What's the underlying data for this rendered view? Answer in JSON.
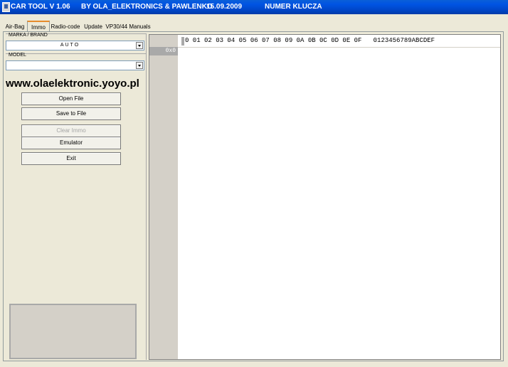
{
  "titlebar": {
    "app_title": "CAR TOOL V 1.06",
    "author": "BY OLA_ELEKTRONICS  &  PAWLENKO",
    "date": "15.09.2009",
    "key_label": "NUMER KLUCZA"
  },
  "tabs": [
    {
      "label": "Air-Bag",
      "active": false
    },
    {
      "label": "Immo",
      "active": true
    },
    {
      "label": "Radio-code",
      "active": false
    },
    {
      "label": "Update",
      "active": false
    },
    {
      "label": "VP30/44 Manuals",
      "active": false
    }
  ],
  "left": {
    "brand_label": "MARKA / BRAND",
    "brand_value": "AUTO",
    "model_label": "MODEL",
    "model_value": "",
    "website": "www.olaelektronic.yoyo.pl",
    "buttons": {
      "open_file": "Open File",
      "save_to_file": "Save to File",
      "clear_immo": "Clear Immo",
      "emulator": "Emulator",
      "exit": "Exit"
    }
  },
  "hex": {
    "header": "0 01 02 03 04 05 06 07 08 09 0A 0B 0C 0D 0E 0F   0123456789ABCDEF",
    "first_address": "0x0"
  },
  "colors": {
    "titlebar": "#0054e3",
    "window_bg": "#ece9d8",
    "active_tab_accent": "#e68b2c"
  }
}
